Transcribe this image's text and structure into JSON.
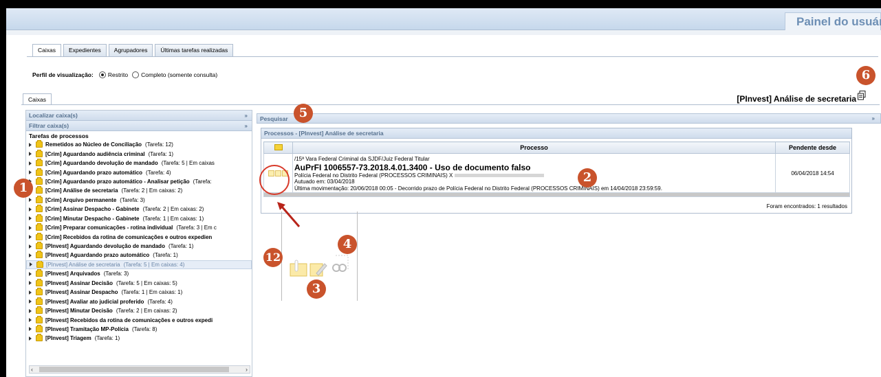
{
  "header": {
    "panel_title": "Painel do usuário"
  },
  "tabs": [
    {
      "label": "Caixas",
      "active": true
    },
    {
      "label": "Expedientes",
      "active": false
    },
    {
      "label": "Agrupadores",
      "active": false
    },
    {
      "label": "Últimas tarefas realizadas",
      "active": false
    }
  ],
  "perfil": {
    "label": "Perfil de visualização:",
    "options": [
      {
        "label": "Restrito",
        "selected": true
      },
      {
        "label": "Completo (somente consulta)",
        "selected": false
      }
    ]
  },
  "caixas_tab": "Caixas",
  "selected_title": "[PInvest] Análise de secretaria",
  "left": {
    "localizar": "Localizar caixa(s)",
    "filtrar": "Filtrar caixa(s)",
    "collapse_glyph": "»",
    "tarefas_title": "Tarefas de processos",
    "tasks": [
      {
        "name": "Remetidos ao Núcleo de Conciliação",
        "count": "(Tarefa: 12)"
      },
      {
        "name": "[Crim] Aguardando audiência criminal",
        "count": "(Tarefa: 1)"
      },
      {
        "name": "[Crim] Aguardando devolução de mandado",
        "count": "(Tarefa: 5 | Em caixas"
      },
      {
        "name": "[Crim] Aguardando prazo automático",
        "count": "(Tarefa: 4)"
      },
      {
        "name": "[Crim] Aguardando prazo automático - Analisar petição",
        "count": "(Tarefa:"
      },
      {
        "name": "[Crim] Análise de secretaria",
        "count": "(Tarefa: 2 | Em caixas: 2)"
      },
      {
        "name": "[Crim] Arquivo permanente",
        "count": "(Tarefa: 3)"
      },
      {
        "name": "[Crim] Assinar Despacho - Gabinete",
        "count": "(Tarefa: 2 | Em caixas: 2)"
      },
      {
        "name": "[Crim] Minutar Despacho - Gabinete",
        "count": "(Tarefa: 1 | Em caixas: 1)"
      },
      {
        "name": "[Crim] Preparar comunicações - rotina individual",
        "count": "(Tarefa: 3 | Em c"
      },
      {
        "name": "[Crim] Recebidos da rotina de comunicações e outros expedien",
        "count": ""
      },
      {
        "name": "[PInvest] Aguardando devolução de mandado",
        "count": "(Tarefa: 1)"
      },
      {
        "name": "[PInvest] Aguardando prazo automático",
        "count": "(Tarefa: 1)"
      },
      {
        "name": "[PInvest] Análise de secretaria",
        "count": "(Tarefa: 5 | Em caixas: 4)",
        "selected": true
      },
      {
        "name": "[PInvest] Arquivados",
        "count": "(Tarefa: 3)"
      },
      {
        "name": "[PInvest] Assinar Decisão",
        "count": "(Tarefa: 5 | Em caixas: 5)"
      },
      {
        "name": "[PInvest] Assinar Despacho",
        "count": "(Tarefa: 1 | Em caixas: 1)"
      },
      {
        "name": "[PInvest] Avaliar ato judicial proferido",
        "count": "(Tarefa: 4)"
      },
      {
        "name": "[PInvest] Minutar Decisão",
        "count": "(Tarefa: 2 | Em caixas: 2)"
      },
      {
        "name": "[PInvest] Recebidos da rotina de comunicações e outros expedi",
        "count": ""
      },
      {
        "name": "[PInvest] Tramitação MP-Polícia",
        "count": "(Tarefa: 8)"
      },
      {
        "name": "[PInvest] Triagem",
        "count": "(Tarefa: 1)"
      }
    ]
  },
  "pesquisar": "Pesquisar",
  "processos": {
    "title": "Processos - [PInvest] Análise de secretaria",
    "col_processo": "Processo",
    "col_pendente": "Pendente desde",
    "row": {
      "orgao": "/15ª Vara Federal Criminal da SJDF/Juiz Federal Titular",
      "numero": "AuPrFI 1006557-73.2018.4.01.3400 - Uso de documento falso",
      "partes": "Polícia Federal no Distrito Federal (PROCESSOS CRIMINAIS) X",
      "autuado": "Autuado em: 03/04/2018",
      "movimentacao": "Última movimentação: 20/06/2018 00:05 - Decorrido prazo de Polícia Federal no Distrito Federal (PROCESSOS CRIMINAIS) em 14/04/2018 23:59:59.",
      "pendente": "06/04/2018 14:54"
    },
    "found": "Foram encontrados: 1 resultados"
  },
  "annotations": [
    "1",
    "2",
    "3",
    "4",
    "5",
    "6",
    "12"
  ],
  "colors": {
    "badge": "#c9532c",
    "accent": "#56718f",
    "title": "#6d8fb5"
  }
}
